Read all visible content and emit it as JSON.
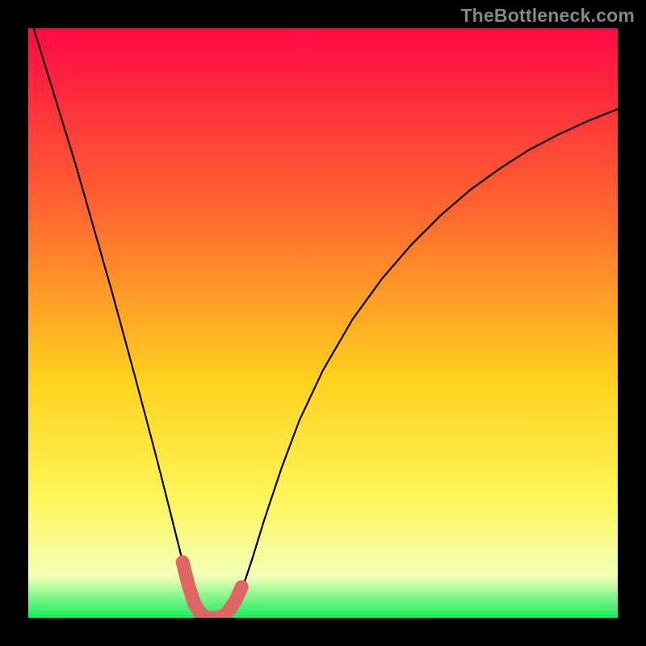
{
  "watermark": "TheBottleneck.com",
  "colors": {
    "page_bg": "#000000",
    "gradient_top": "#ff0944",
    "gradient_upper": "#ff6a2f",
    "gradient_mid": "#ffd21e",
    "gradient_lower": "#fff65a",
    "gradient_pale": "#f2ffb8",
    "gradient_bottom": "#16ec5c",
    "curve": "#000000",
    "marker_fill": "#e06666",
    "marker_stroke": "#d04a4a"
  },
  "chart_data": {
    "type": "line",
    "title": "",
    "xlabel": "",
    "ylabel": "",
    "xlim": [
      0,
      1
    ],
    "ylim": [
      0,
      1
    ],
    "x": [
      0.0,
      0.02,
      0.04,
      0.06,
      0.08,
      0.1,
      0.12,
      0.14,
      0.16,
      0.18,
      0.2,
      0.22,
      0.24,
      0.26,
      0.275,
      0.29,
      0.305,
      0.32,
      0.335,
      0.35,
      0.365,
      0.38,
      0.4,
      0.43,
      0.46,
      0.5,
      0.55,
      0.6,
      0.65,
      0.7,
      0.75,
      0.8,
      0.85,
      0.9,
      0.95,
      1.0
    ],
    "values": [
      1.03,
      0.965,
      0.9,
      0.835,
      0.77,
      0.7,
      0.63,
      0.56,
      0.487,
      0.413,
      0.338,
      0.262,
      0.183,
      0.103,
      0.048,
      0.012,
      0.0,
      0.0,
      0.004,
      0.022,
      0.055,
      0.1,
      0.165,
      0.255,
      0.335,
      0.42,
      0.506,
      0.575,
      0.633,
      0.683,
      0.726,
      0.762,
      0.794,
      0.82,
      0.843,
      0.863
    ],
    "markers": {
      "x": [
        0.262,
        0.272,
        0.282,
        0.292,
        0.302,
        0.312,
        0.322,
        0.332,
        0.342,
        0.352,
        0.362
      ],
      "y": [
        0.094,
        0.054,
        0.024,
        0.008,
        0.0,
        0.0,
        0.0,
        0.003,
        0.014,
        0.03,
        0.052
      ]
    },
    "annotations": []
  }
}
